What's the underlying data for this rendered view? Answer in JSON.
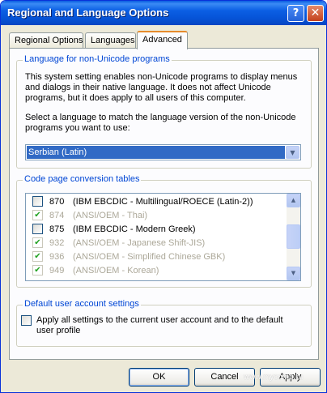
{
  "window": {
    "title": "Regional and Language Options",
    "help_glyph": "?",
    "close_glyph": "✕"
  },
  "tabs": [
    {
      "label": "Regional Options",
      "active": false
    },
    {
      "label": "Languages",
      "active": false
    },
    {
      "label": "Advanced",
      "active": true
    }
  ],
  "nonunicode": {
    "title": "Language for non-Unicode programs",
    "description": "This system setting enables non-Unicode programs to display menus and dialogs in their native language. It does not affect Unicode programs, but it does apply to all users of this computer.",
    "instruction": "Select a language to match the language version of the non-Unicode programs you want to use:",
    "selected_language": "Serbian (Latin)",
    "dropdown_glyph": "▼"
  },
  "codepages": {
    "title": "Code page conversion tables",
    "items": [
      {
        "code": "870",
        "name": "(IBM EBCDIC - Multilingual/ROECE (Latin-2))",
        "checked": false,
        "disabled": false
      },
      {
        "code": "874",
        "name": "(ANSI/OEM - Thai)",
        "checked": true,
        "disabled": true
      },
      {
        "code": "875",
        "name": "(IBM EBCDIC - Modern Greek)",
        "checked": false,
        "disabled": false
      },
      {
        "code": "932",
        "name": "(ANSI/OEM - Japanese Shift-JIS)",
        "checked": true,
        "disabled": true
      },
      {
        "code": "936",
        "name": "(ANSI/OEM - Simplified Chinese GBK)",
        "checked": true,
        "disabled": true
      },
      {
        "code": "949",
        "name": "(ANSI/OEM - Korean)",
        "checked": true,
        "disabled": true
      }
    ],
    "scroll_up_glyph": "▲",
    "scroll_down_glyph": "▼",
    "check_glyph": "✔"
  },
  "default_user": {
    "title": "Default user account settings",
    "checkbox_label": "Apply all settings to the current user account and to the default user profile",
    "checked": false
  },
  "buttons": {
    "ok": "OK",
    "cancel": "Cancel",
    "apply": "Apply"
  },
  "watermark": "www.mycomp.ru"
}
